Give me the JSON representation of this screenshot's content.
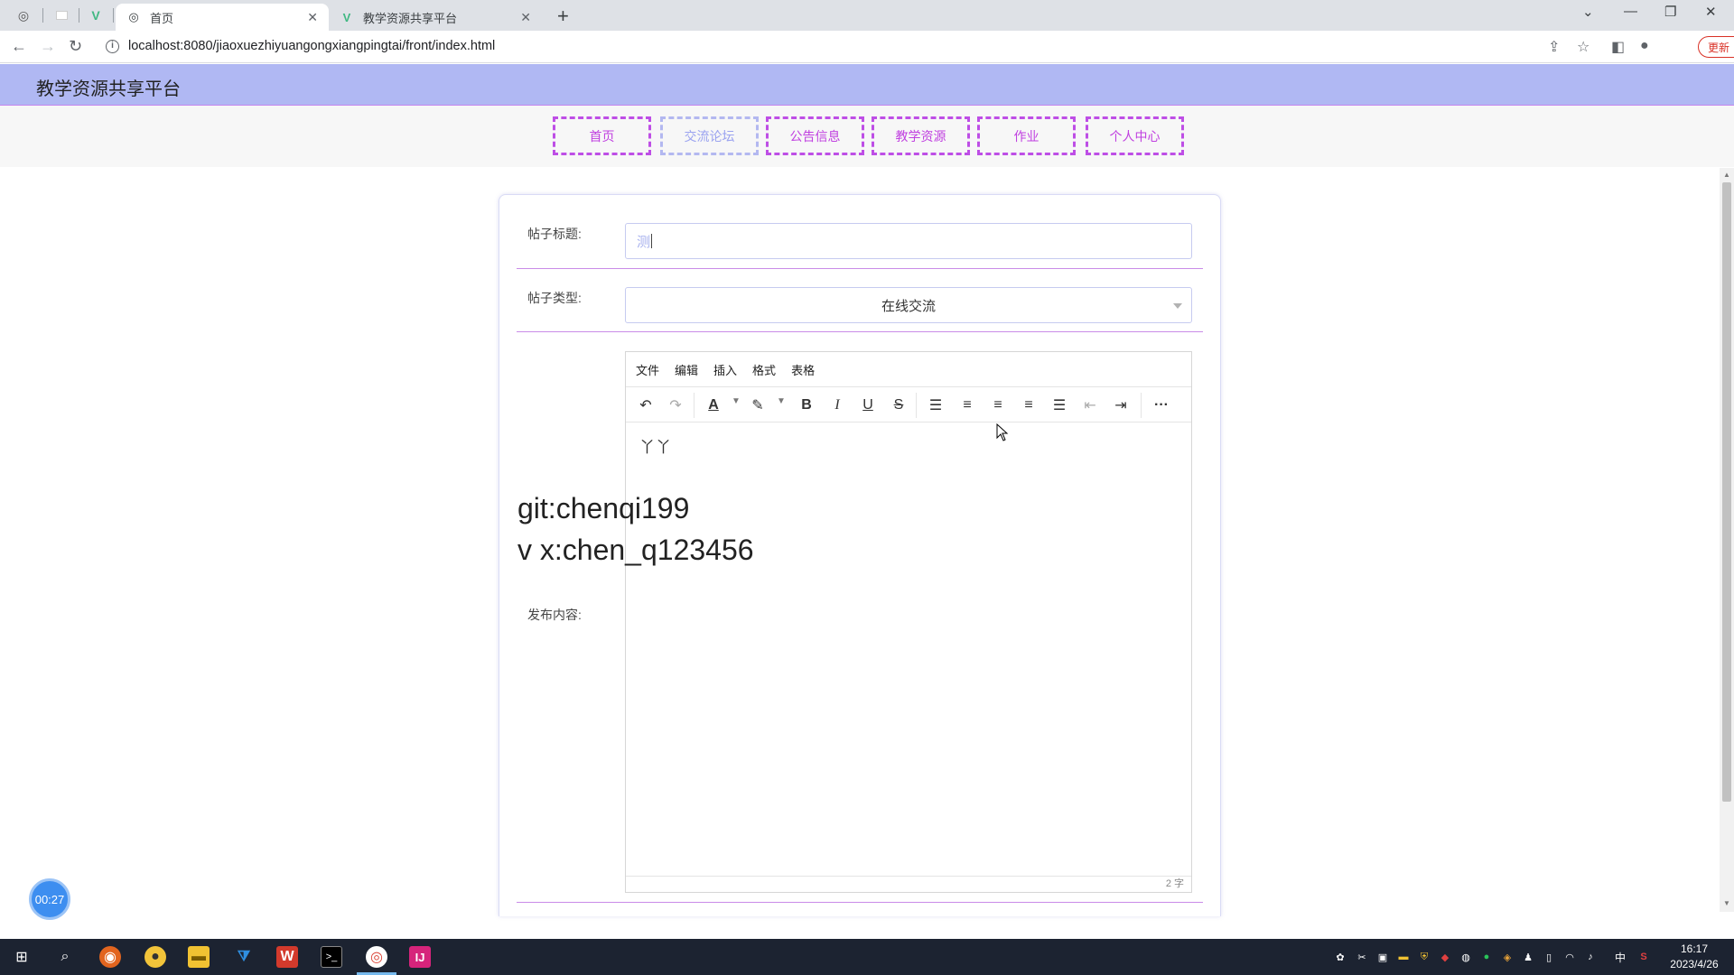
{
  "browser": {
    "tabs": [
      {
        "title": "首页",
        "active": true
      },
      {
        "title": "教学资源共享平台",
        "active": false
      }
    ],
    "new_tab": "+",
    "url": "localhost:8080/jiaoxuezhiyuangongxiangpingtai/front/index.html",
    "update_label": "更新"
  },
  "site": {
    "title": "教学资源共享平台",
    "nav": [
      {
        "label": "首页"
      },
      {
        "label": "交流论坛",
        "active": true
      },
      {
        "label": "公告信息"
      },
      {
        "label": "教学资源"
      },
      {
        "label": "作业"
      },
      {
        "label": "个人中心"
      }
    ]
  },
  "form": {
    "title_label": "帖子标题:",
    "title_value": "测",
    "type_label": "帖子类型:",
    "type_value": "在线交流",
    "content_label": "发布内容:"
  },
  "editor": {
    "menus": [
      "文件",
      "编辑",
      "插入",
      "格式",
      "表格"
    ],
    "content": "丫丫",
    "word_count": "2 字"
  },
  "overlay": {
    "line1": "git:chenqi199",
    "line2": "v x:chen_q123456"
  },
  "timer": "00:27",
  "taskbar": {
    "time": "16:17",
    "date": "2023/4/26",
    "ime": "中"
  },
  "colors": {
    "header_bg": "#b0b8f3",
    "nav_border": "#be4ee6",
    "accent_line": "#c98ce8",
    "timer_bg": "#3d8ef0"
  }
}
